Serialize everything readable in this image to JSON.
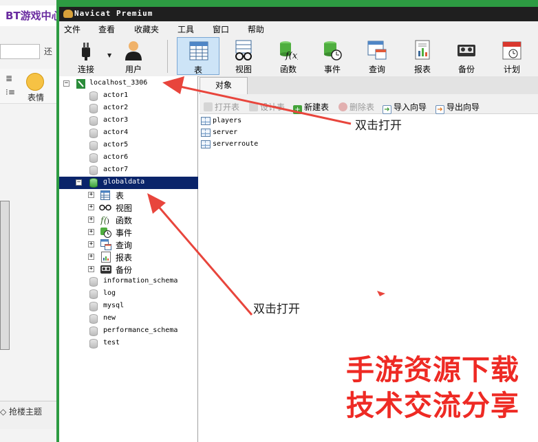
{
  "background_page": {
    "title": "BT游戏中心",
    "input_button": "还",
    "emoji_label": "表情",
    "list_icon_1": "≣",
    "list_icon_2": "⁝≡",
    "bottom_button": "◇ 抢楼主题"
  },
  "window": {
    "title": "Navicat Premium"
  },
  "menu": [
    "文件",
    "查看",
    "收藏夹",
    "工具",
    "窗口",
    "帮助"
  ],
  "toolbar": {
    "buttons": [
      {
        "label": "连接",
        "icon": "plug-icon"
      },
      {
        "label": "用户",
        "icon": "user-icon"
      },
      {
        "label": "表",
        "icon": "table-icon",
        "active": true
      },
      {
        "label": "视图",
        "icon": "glasses-icon"
      },
      {
        "label": "函数",
        "icon": "function-icon"
      },
      {
        "label": "事件",
        "icon": "clock-db-icon"
      },
      {
        "label": "查询",
        "icon": "query-icon"
      },
      {
        "label": "报表",
        "icon": "report-icon"
      },
      {
        "label": "备份",
        "icon": "tape-icon"
      },
      {
        "label": "计划",
        "icon": "calendar-icon"
      }
    ]
  },
  "tree": {
    "connection": "localhost_3306",
    "databases_top": [
      "actor1",
      "actor2",
      "actor3",
      "actor4",
      "actor5",
      "actor6",
      "actor7"
    ],
    "open_database": "globaldata",
    "children": [
      "表",
      "视图",
      "函数",
      "事件",
      "查询",
      "报表",
      "备份"
    ],
    "databases_bottom": [
      "information_schema",
      "log",
      "mysql",
      "new",
      "performance_schema",
      "test"
    ]
  },
  "objects_tab": {
    "label": "对象"
  },
  "object_toolbar": {
    "open_table": "打开表",
    "design_table": "设计表",
    "new_table": "新建表",
    "delete_table": "删除表",
    "import_wizard": "导入向导",
    "export_wizard": "导出向导"
  },
  "tables": [
    "players",
    "server",
    "serverroute"
  ],
  "annotations": {
    "top": "双击打开",
    "bottom": "双击打开"
  },
  "watermark": {
    "line1": "手游资源下载",
    "line2": "技术交流分享"
  },
  "colors": {
    "window_frame": "#2d9b42",
    "selection": "#0a246a",
    "arrow": "#e8453c",
    "watermark": "#ee2a24",
    "active_tab": "#cde4f7"
  }
}
